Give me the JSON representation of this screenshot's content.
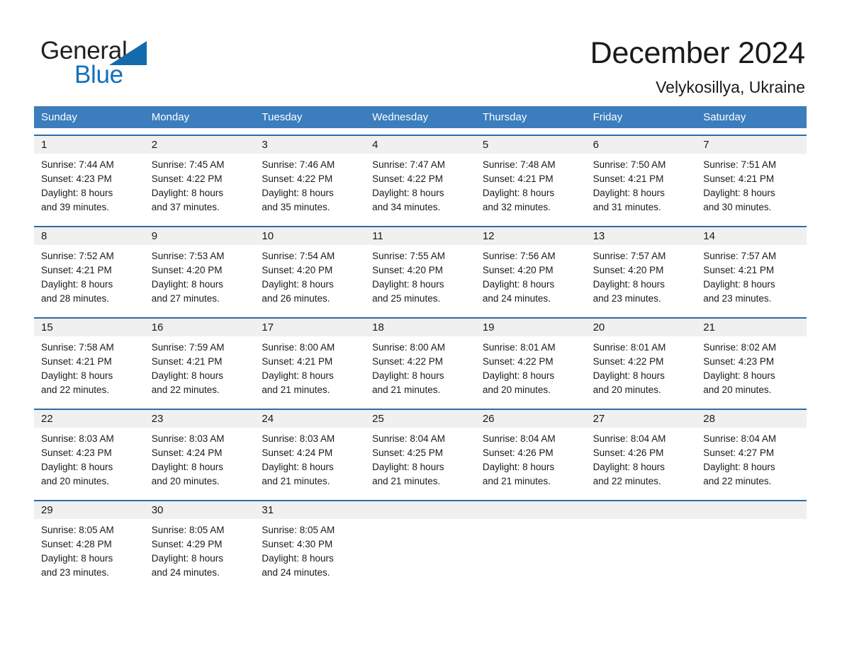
{
  "brand": {
    "name_part1": "General",
    "name_part2": "Blue",
    "triangle_color": "#146aab",
    "blue_color": "#1271bb"
  },
  "header": {
    "title": "December 2024",
    "subtitle": "Velykosillya, Ukraine"
  },
  "theme": {
    "header_row_bg": "#3b7dbd",
    "week_border": "#2e6da4",
    "day_number_bg": "#f0f0f0",
    "text_color": "#1a1a1a"
  },
  "weekdays": [
    "Sunday",
    "Monday",
    "Tuesday",
    "Wednesday",
    "Thursday",
    "Friday",
    "Saturday"
  ],
  "weeks": [
    [
      {
        "day": "1",
        "sunrise": "Sunrise: 7:44 AM",
        "sunset": "Sunset: 4:23 PM",
        "daylight1": "Daylight: 8 hours",
        "daylight2": "and 39 minutes."
      },
      {
        "day": "2",
        "sunrise": "Sunrise: 7:45 AM",
        "sunset": "Sunset: 4:22 PM",
        "daylight1": "Daylight: 8 hours",
        "daylight2": "and 37 minutes."
      },
      {
        "day": "3",
        "sunrise": "Sunrise: 7:46 AM",
        "sunset": "Sunset: 4:22 PM",
        "daylight1": "Daylight: 8 hours",
        "daylight2": "and 35 minutes."
      },
      {
        "day": "4",
        "sunrise": "Sunrise: 7:47 AM",
        "sunset": "Sunset: 4:22 PM",
        "daylight1": "Daylight: 8 hours",
        "daylight2": "and 34 minutes."
      },
      {
        "day": "5",
        "sunrise": "Sunrise: 7:48 AM",
        "sunset": "Sunset: 4:21 PM",
        "daylight1": "Daylight: 8 hours",
        "daylight2": "and 32 minutes."
      },
      {
        "day": "6",
        "sunrise": "Sunrise: 7:50 AM",
        "sunset": "Sunset: 4:21 PM",
        "daylight1": "Daylight: 8 hours",
        "daylight2": "and 31 minutes."
      },
      {
        "day": "7",
        "sunrise": "Sunrise: 7:51 AM",
        "sunset": "Sunset: 4:21 PM",
        "daylight1": "Daylight: 8 hours",
        "daylight2": "and 30 minutes."
      }
    ],
    [
      {
        "day": "8",
        "sunrise": "Sunrise: 7:52 AM",
        "sunset": "Sunset: 4:21 PM",
        "daylight1": "Daylight: 8 hours",
        "daylight2": "and 28 minutes."
      },
      {
        "day": "9",
        "sunrise": "Sunrise: 7:53 AM",
        "sunset": "Sunset: 4:20 PM",
        "daylight1": "Daylight: 8 hours",
        "daylight2": "and 27 minutes."
      },
      {
        "day": "10",
        "sunrise": "Sunrise: 7:54 AM",
        "sunset": "Sunset: 4:20 PM",
        "daylight1": "Daylight: 8 hours",
        "daylight2": "and 26 minutes."
      },
      {
        "day": "11",
        "sunrise": "Sunrise: 7:55 AM",
        "sunset": "Sunset: 4:20 PM",
        "daylight1": "Daylight: 8 hours",
        "daylight2": "and 25 minutes."
      },
      {
        "day": "12",
        "sunrise": "Sunrise: 7:56 AM",
        "sunset": "Sunset: 4:20 PM",
        "daylight1": "Daylight: 8 hours",
        "daylight2": "and 24 minutes."
      },
      {
        "day": "13",
        "sunrise": "Sunrise: 7:57 AM",
        "sunset": "Sunset: 4:20 PM",
        "daylight1": "Daylight: 8 hours",
        "daylight2": "and 23 minutes."
      },
      {
        "day": "14",
        "sunrise": "Sunrise: 7:57 AM",
        "sunset": "Sunset: 4:21 PM",
        "daylight1": "Daylight: 8 hours",
        "daylight2": "and 23 minutes."
      }
    ],
    [
      {
        "day": "15",
        "sunrise": "Sunrise: 7:58 AM",
        "sunset": "Sunset: 4:21 PM",
        "daylight1": "Daylight: 8 hours",
        "daylight2": "and 22 minutes."
      },
      {
        "day": "16",
        "sunrise": "Sunrise: 7:59 AM",
        "sunset": "Sunset: 4:21 PM",
        "daylight1": "Daylight: 8 hours",
        "daylight2": "and 22 minutes."
      },
      {
        "day": "17",
        "sunrise": "Sunrise: 8:00 AM",
        "sunset": "Sunset: 4:21 PM",
        "daylight1": "Daylight: 8 hours",
        "daylight2": "and 21 minutes."
      },
      {
        "day": "18",
        "sunrise": "Sunrise: 8:00 AM",
        "sunset": "Sunset: 4:22 PM",
        "daylight1": "Daylight: 8 hours",
        "daylight2": "and 21 minutes."
      },
      {
        "day": "19",
        "sunrise": "Sunrise: 8:01 AM",
        "sunset": "Sunset: 4:22 PM",
        "daylight1": "Daylight: 8 hours",
        "daylight2": "and 20 minutes."
      },
      {
        "day": "20",
        "sunrise": "Sunrise: 8:01 AM",
        "sunset": "Sunset: 4:22 PM",
        "daylight1": "Daylight: 8 hours",
        "daylight2": "and 20 minutes."
      },
      {
        "day": "21",
        "sunrise": "Sunrise: 8:02 AM",
        "sunset": "Sunset: 4:23 PM",
        "daylight1": "Daylight: 8 hours",
        "daylight2": "and 20 minutes."
      }
    ],
    [
      {
        "day": "22",
        "sunrise": "Sunrise: 8:03 AM",
        "sunset": "Sunset: 4:23 PM",
        "daylight1": "Daylight: 8 hours",
        "daylight2": "and 20 minutes."
      },
      {
        "day": "23",
        "sunrise": "Sunrise: 8:03 AM",
        "sunset": "Sunset: 4:24 PM",
        "daylight1": "Daylight: 8 hours",
        "daylight2": "and 20 minutes."
      },
      {
        "day": "24",
        "sunrise": "Sunrise: 8:03 AM",
        "sunset": "Sunset: 4:24 PM",
        "daylight1": "Daylight: 8 hours",
        "daylight2": "and 21 minutes."
      },
      {
        "day": "25",
        "sunrise": "Sunrise: 8:04 AM",
        "sunset": "Sunset: 4:25 PM",
        "daylight1": "Daylight: 8 hours",
        "daylight2": "and 21 minutes."
      },
      {
        "day": "26",
        "sunrise": "Sunrise: 8:04 AM",
        "sunset": "Sunset: 4:26 PM",
        "daylight1": "Daylight: 8 hours",
        "daylight2": "and 21 minutes."
      },
      {
        "day": "27",
        "sunrise": "Sunrise: 8:04 AM",
        "sunset": "Sunset: 4:26 PM",
        "daylight1": "Daylight: 8 hours",
        "daylight2": "and 22 minutes."
      },
      {
        "day": "28",
        "sunrise": "Sunrise: 8:04 AM",
        "sunset": "Sunset: 4:27 PM",
        "daylight1": "Daylight: 8 hours",
        "daylight2": "and 22 minutes."
      }
    ],
    [
      {
        "day": "29",
        "sunrise": "Sunrise: 8:05 AM",
        "sunset": "Sunset: 4:28 PM",
        "daylight1": "Daylight: 8 hours",
        "daylight2": "and 23 minutes."
      },
      {
        "day": "30",
        "sunrise": "Sunrise: 8:05 AM",
        "sunset": "Sunset: 4:29 PM",
        "daylight1": "Daylight: 8 hours",
        "daylight2": "and 24 minutes."
      },
      {
        "day": "31",
        "sunrise": "Sunrise: 8:05 AM",
        "sunset": "Sunset: 4:30 PM",
        "daylight1": "Daylight: 8 hours",
        "daylight2": "and 24 minutes."
      },
      {
        "day": "",
        "sunrise": "",
        "sunset": "",
        "daylight1": "",
        "daylight2": ""
      },
      {
        "day": "",
        "sunrise": "",
        "sunset": "",
        "daylight1": "",
        "daylight2": ""
      },
      {
        "day": "",
        "sunrise": "",
        "sunset": "",
        "daylight1": "",
        "daylight2": ""
      },
      {
        "day": "",
        "sunrise": "",
        "sunset": "",
        "daylight1": "",
        "daylight2": ""
      }
    ]
  ]
}
